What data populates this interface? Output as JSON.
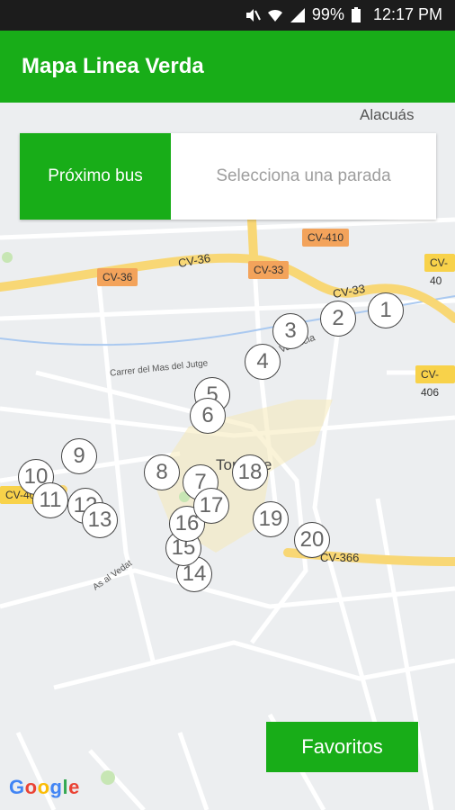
{
  "status_bar": {
    "battery": "99%",
    "time": "12:17 PM"
  },
  "app_bar": {
    "title": "Mapa Linea Verda"
  },
  "search_card": {
    "next_bus_label": "Próximo bus",
    "stop_placeholder": "Selecciona una parada"
  },
  "favorites_label": "Favoritos",
  "map": {
    "places": {
      "alacuas": "Alacuás",
      "torrente": "Torrente",
      "mas_del_jutge": "Carrer del Mas del Jutge",
      "valencia": "Valencia",
      "as_al_vedat": "As al Vedat"
    },
    "road_shields": {
      "cv36": "CV-36",
      "cv33": "CV-33",
      "cv410": "CV-410",
      "cv40": "CV-40",
      "cv406": "CV-406",
      "cv405": "CV-40",
      "road_cv36": "CV-36",
      "road_cv33": "CV-33",
      "road_cv366": "CV-366"
    },
    "google": "Google"
  },
  "stops": [
    "1",
    "2",
    "3",
    "4",
    "5",
    "6",
    "7",
    "8",
    "9",
    "10",
    "11",
    "12",
    "13",
    "14",
    "15",
    "16",
    "17",
    "18",
    "19",
    "20"
  ],
  "colors": {
    "primary": "#18ad18",
    "status_bar": "#1c1c1c",
    "highway": "#f8d775"
  }
}
